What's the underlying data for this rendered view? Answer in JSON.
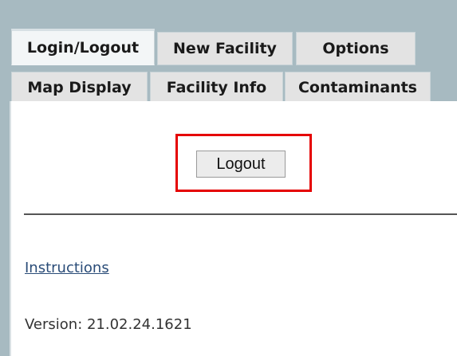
{
  "tabs": {
    "row1": [
      "Login/Logout",
      "New Facility",
      "Options"
    ],
    "row2": [
      "Map Display",
      "Facility Info",
      "Contaminants"
    ]
  },
  "panel": {
    "logout_label": "Logout",
    "instructions_label": "Instructions",
    "version_text": "Version: 21.02.24.1621"
  },
  "colors": {
    "background": "#a7bac1",
    "tab_fill": "#e3e3e3",
    "active_tab_fill": "#f3f6f7",
    "highlight": "#e50000",
    "link": "#2a4c78"
  }
}
